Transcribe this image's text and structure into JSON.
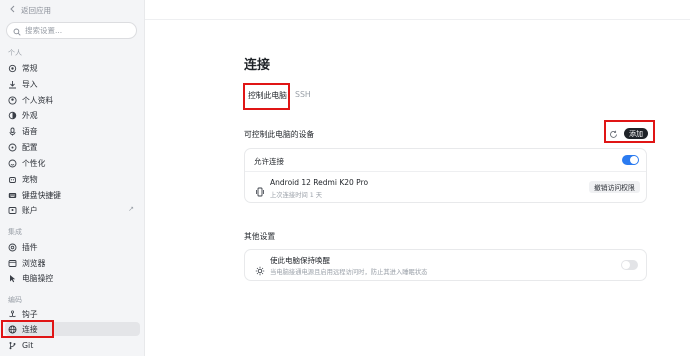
{
  "sidebar": {
    "back_label": "返回应用",
    "search_placeholder": "搜索设置...",
    "groups": {
      "personal": "个人",
      "integrations": "集成",
      "coding": "编码"
    },
    "items": [
      {
        "label": "常规",
        "icon": "gear-icon"
      },
      {
        "label": "导入",
        "icon": "import-icon"
      },
      {
        "label": "个人资料",
        "icon": "user-icon"
      },
      {
        "label": "外观",
        "icon": "sun-icon"
      },
      {
        "label": "语音",
        "icon": "microphone-icon"
      },
      {
        "label": "配置",
        "icon": "sliders-icon"
      },
      {
        "label": "个性化",
        "icon": "smile-icon"
      },
      {
        "label": "宠物",
        "icon": "pet-icon"
      },
      {
        "label": "键盘快捷键",
        "icon": "keyboard-icon"
      },
      {
        "label": "账户",
        "icon": "account-icon",
        "ext": "↗"
      },
      {
        "label": "插件",
        "icon": "plugin-icon"
      },
      {
        "label": "浏览器",
        "icon": "browser-icon"
      },
      {
        "label": "电脑操控",
        "icon": "cursor-icon"
      },
      {
        "label": "钩子",
        "icon": "hook-icon"
      },
      {
        "label": "连接",
        "icon": "globe-icon",
        "active": true
      },
      {
        "label": "Git",
        "icon": "git-branch-icon"
      }
    ]
  },
  "main": {
    "title": "连接",
    "tabs": [
      {
        "label": "控制此电脑",
        "active": true
      },
      {
        "label": "SSH",
        "active": false
      }
    ],
    "devices_section": {
      "title": "可控制此电脑的设备",
      "add_label": "添加",
      "allow_label": "允许连接",
      "allow_enabled": true,
      "device": {
        "name": "Android 12 Redmi K20 Pro",
        "last_connected": "上次连接时间 1 天",
        "revoke_label": "撤销访问权限"
      }
    },
    "other_section": {
      "title": "其他设置",
      "keep_awake_label": "使此电脑保持唤醒",
      "keep_awake_desc": "当电脑接通电源且启用远程访问时，防止其进入睡眠状态",
      "keep_awake_enabled": false
    }
  },
  "colors": {
    "accent": "#2b7bf0",
    "highlight_box": "#e01515",
    "sidebar_bg": "#f4f5f7"
  }
}
